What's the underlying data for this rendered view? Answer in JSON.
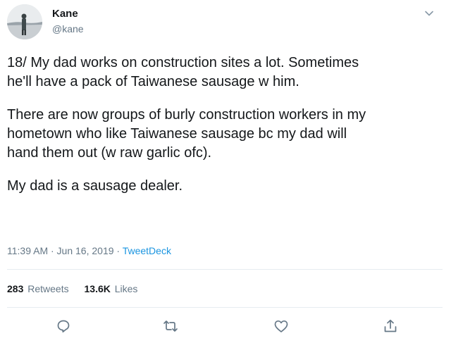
{
  "user": {
    "display_name": "Kane",
    "handle": "@kane"
  },
  "icons": {
    "avatar": "profile-photo",
    "menu": "chevron-down-icon",
    "reply": "reply-icon",
    "retweet": "retweet-icon",
    "like": "like-icon",
    "share": "share-icon"
  },
  "tweet": {
    "paragraphs": [
      "18/ My dad works on construction sites a lot. Sometimes\nhe'll have a pack of Taiwanese sausage w him.",
      "There are now groups of burly construction workers in my\nhometown who like Taiwanese sausage bc my dad will\nhand them out (w raw garlic ofc).",
      "My dad is a sausage dealer."
    ],
    "timestamp": "11:39 AM · Jun 16, 2019 · ",
    "source": "TweetDeck"
  },
  "stats": {
    "retweets_count": "283",
    "retweets_label": "Retweets",
    "likes_count": "13.6K",
    "likes_label": "Likes"
  },
  "colors": {
    "text_primary": "#14171a",
    "text_secondary": "#657786",
    "link": "#1b95e0",
    "divider": "#e6ecf0"
  }
}
